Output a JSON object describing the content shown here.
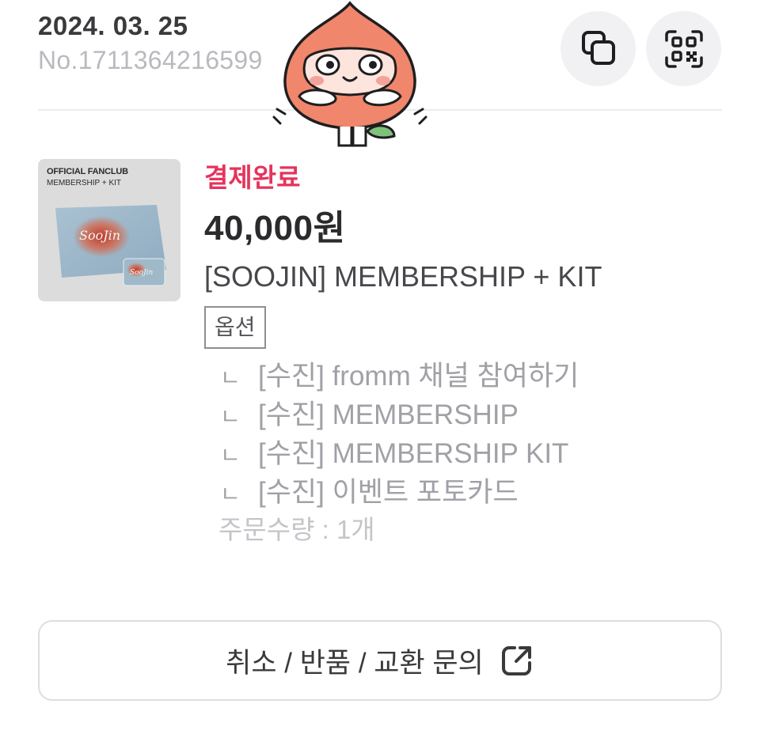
{
  "order": {
    "date": "2024. 03. 25",
    "number": "No.1711364216599"
  },
  "actions": {
    "copy_icon": "copy-icon",
    "qr_icon": "qr-code-icon"
  },
  "item": {
    "thumbnail": {
      "title": "OFFICIAL FANCLUB",
      "subtitle": "MEMBERSHIP + KIT",
      "logo_text": "SooJin"
    },
    "status": "결제완료",
    "price": "40,000원",
    "name": "[SOOJIN] MEMBERSHIP + KIT",
    "option_label": "옵션",
    "option_marker": "ㄴ",
    "options": [
      "[수진] fromm 채널 참여하기",
      "[수진] MEMBERSHIP",
      "[수진] MEMBERSHIP KIT",
      "[수진] 이벤트 포토카드"
    ],
    "quantity": "주문수량 : 1개"
  },
  "inquiry": {
    "label": "취소 / 반품 / 교환 문의",
    "icon": "external-link-icon"
  },
  "colors": {
    "status": "#e6335c",
    "sticker": "#f0866b"
  }
}
